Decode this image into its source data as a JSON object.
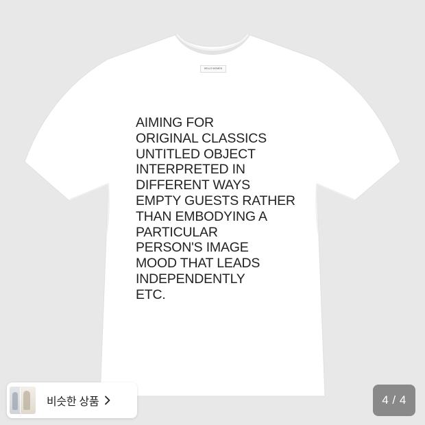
{
  "product": {
    "neck_label": "HELLO WOMEN",
    "print_lines": [
      "AIMING FOR",
      "ORIGINAL CLASSICS",
      "UNTITLED OBJECT",
      "INTERPRETED IN",
      "DIFFERENT WAYS",
      "EMPTY GUESTS RATHER",
      "THAN EMBODYING A",
      "PARTICULAR",
      "PERSON'S IMAGE",
      "MOOD THAT LEADS",
      "INDEPENDENTLY",
      "ETC."
    ]
  },
  "similar_products": {
    "label": "비슷한 상품",
    "icon": "chevron-right-icon"
  },
  "pager": {
    "text": "4 / 4",
    "current": 4,
    "total": 4
  },
  "colors": {
    "background": "#e8e8e8",
    "shirt": "#ffffff",
    "print": "#222222",
    "counter_bg": "#646464"
  }
}
